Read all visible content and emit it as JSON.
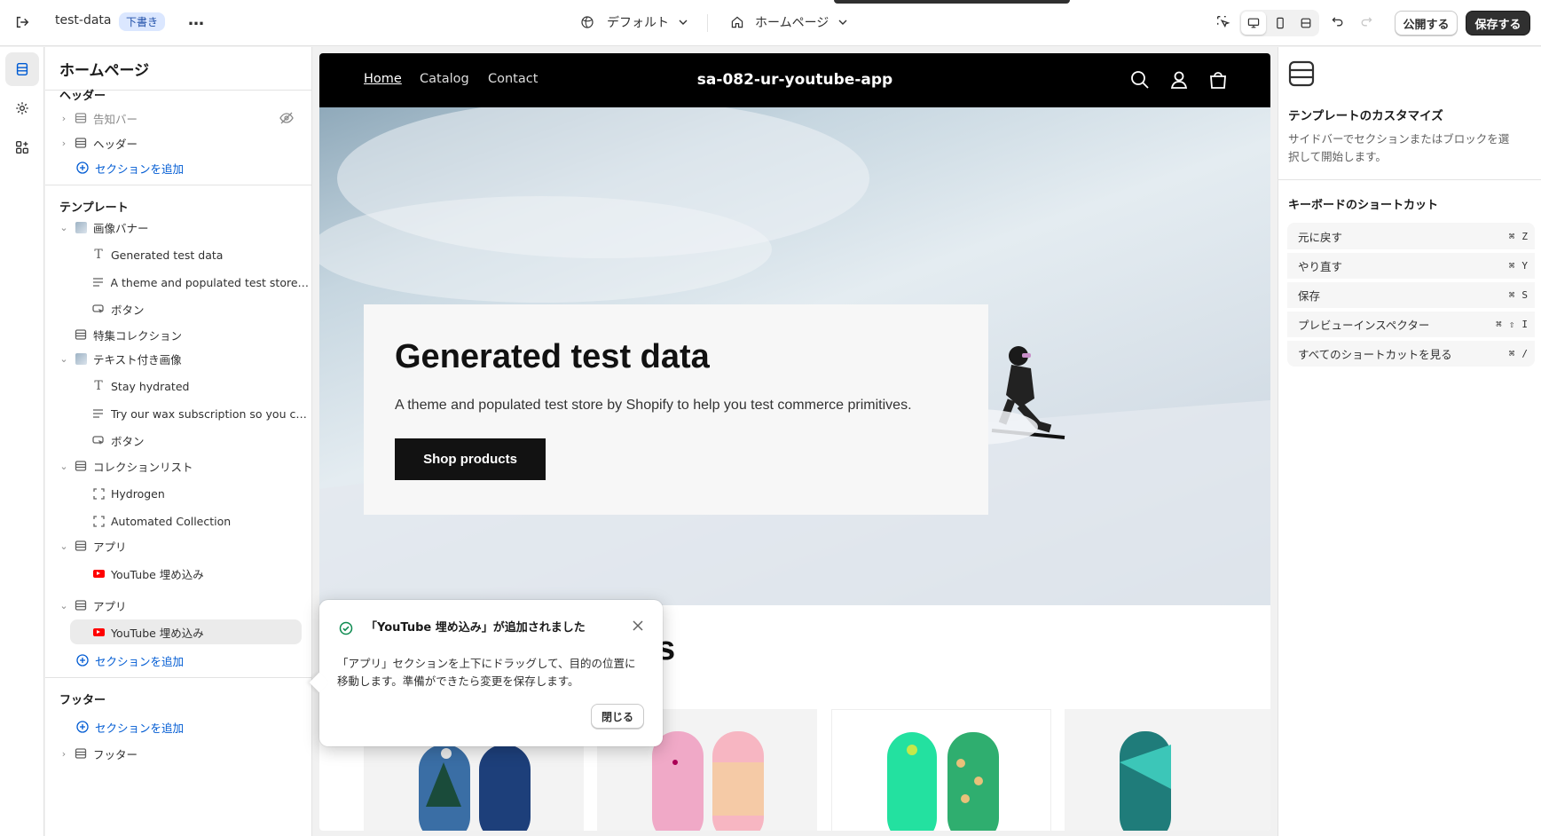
{
  "topbar": {
    "store_name": "test-data",
    "draft_badge": "下書き",
    "more": "…",
    "theme_select": "デフォルト",
    "page_select": "ホームページ",
    "publish_label": "公開する",
    "save_label": "保存する"
  },
  "sidebar": {
    "title": "ホームページ",
    "header_group": "ヘッダー",
    "header_items": [
      {
        "label": "告知バー"
      },
      {
        "label": "ヘッダー"
      }
    ],
    "add_section": "セクションを追加",
    "template_group": "テンプレート",
    "template_items": [
      {
        "label": "画像バナー"
      },
      {
        "label": "Generated test data"
      },
      {
        "label": "A theme and populated test store b..."
      },
      {
        "label": "ボタン"
      },
      {
        "label": "特集コレクション"
      },
      {
        "label": "テキスト付き画像"
      },
      {
        "label": "Stay hydrated"
      },
      {
        "label": "Try our wax subscription so you ca..."
      },
      {
        "label": "ボタン"
      },
      {
        "label": "コレクションリスト"
      },
      {
        "label": "Hydrogen"
      },
      {
        "label": "Automated Collection"
      },
      {
        "label": "アプリ"
      },
      {
        "label": "YouTube 埋め込み"
      },
      {
        "label": "アプリ"
      },
      {
        "label": "YouTube 埋め込み"
      }
    ],
    "footer_group": "フッター",
    "footer_item": "フッター"
  },
  "preview": {
    "nav": [
      "Home",
      "Catalog",
      "Contact"
    ],
    "store_title": "sa-082-ur-youtube-app",
    "hero_heading": "Generated test data",
    "hero_text": "A theme and populated test store by Shopify to help you test commerce primitives.",
    "hero_button": "Shop products",
    "section_heading_fragment": "s"
  },
  "toast": {
    "title": "「YouTube 埋め込み」が追加されました",
    "body": "「アプリ」セクションを上下にドラッグして、目的の位置に移動します。準備ができたら変更を保存します。",
    "close_button": "閉じる"
  },
  "right_panel": {
    "title": "テンプレートのカスタマイズ",
    "description": "サイドバーでセクションまたはブロックを選択して開始します。",
    "shortcuts_title": "キーボードのショートカット",
    "shortcuts": [
      {
        "label": "元に戻す",
        "keys": [
          "⌘",
          "Z"
        ]
      },
      {
        "label": "やり直す",
        "keys": [
          "⌘",
          "Y"
        ]
      },
      {
        "label": "保存",
        "keys": [
          "⌘",
          "S"
        ]
      },
      {
        "label": "プレビューインスペクター",
        "keys": [
          "⌘",
          "⇧",
          "I"
        ]
      },
      {
        "label": "すべてのショートカットを見る",
        "keys": [
          "⌘",
          "/"
        ]
      }
    ]
  },
  "colors": {
    "accent_blue": "#005bd3",
    "primary_button": "#303030",
    "success_green": "#0c8a4f",
    "youtube_red": "#ff0000"
  }
}
